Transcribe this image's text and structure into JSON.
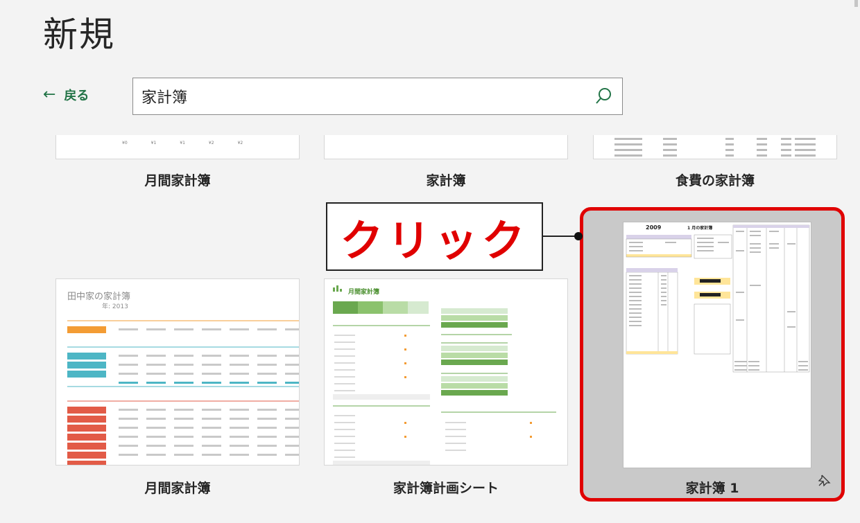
{
  "page": {
    "title": "新規"
  },
  "nav": {
    "back_label": "戻る"
  },
  "search": {
    "value": "家計簿",
    "placeholder": ""
  },
  "templates_top": [
    {
      "caption": "月間家計簿",
      "snippet": [
        "¥0",
        "¥1",
        "¥1",
        "¥2",
        "¥2"
      ]
    },
    {
      "caption": "家計簿"
    },
    {
      "caption": "食費の家計簿"
    }
  ],
  "templates_bottom": [
    {
      "caption": "月間家計簿",
      "preview_title": "田中家の家計簿",
      "preview_year": "年: 2013"
    },
    {
      "caption": "家計簿計画シート",
      "preview_title": "月間家計簿"
    },
    {
      "caption": "家計簿 1",
      "preview_year": "2009",
      "preview_title": "1 月の家計簿",
      "selected": true
    }
  ],
  "callout": {
    "text": "クリック"
  },
  "colors": {
    "accent": "#217346",
    "highlight": "#e00000"
  }
}
